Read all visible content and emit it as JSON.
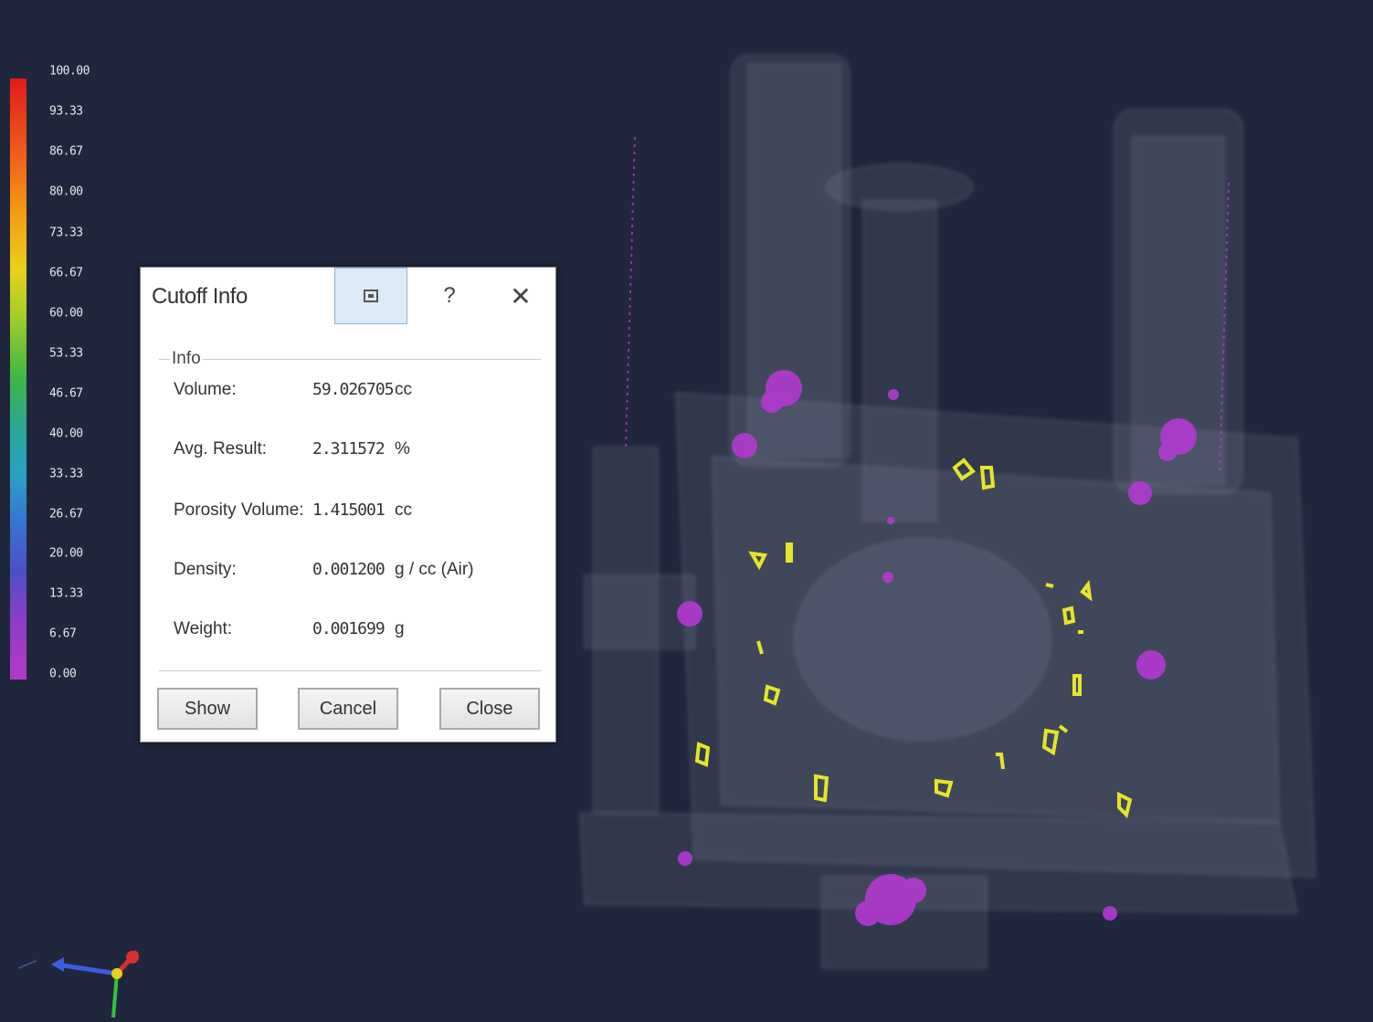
{
  "legend": {
    "labels": [
      "100.00",
      "93.33",
      "86.67",
      "80.00",
      "73.33",
      "66.67",
      "60.00",
      "53.33",
      "46.67",
      "40.00",
      "33.33",
      "26.67",
      "20.00",
      "13.33",
      "6.67",
      "0.00"
    ]
  },
  "dialog": {
    "title": "Cutoff Info",
    "help_glyph": "?",
    "close_glyph": "✕",
    "group_title": "Info",
    "rows": [
      {
        "label": "Volume:",
        "value": "59.026705",
        "unit": "cc"
      },
      {
        "label": "Avg. Result:",
        "value": "2.311572",
        "unit": "%"
      },
      {
        "label": "Porosity Volume:",
        "value": "1.415001",
        "unit": "cc"
      },
      {
        "label": "Density:",
        "value": "0.001200",
        "unit": "g / cc  (Air)"
      },
      {
        "label": "Weight:",
        "value": "0.001699",
        "unit": "g"
      }
    ],
    "buttons": {
      "show": "Show",
      "cancel": "Cancel",
      "close": "Close"
    }
  },
  "colors": {
    "background": "#20263b",
    "porosity_low": "#b23ad0",
    "porosity_high": "#e5e52a"
  }
}
